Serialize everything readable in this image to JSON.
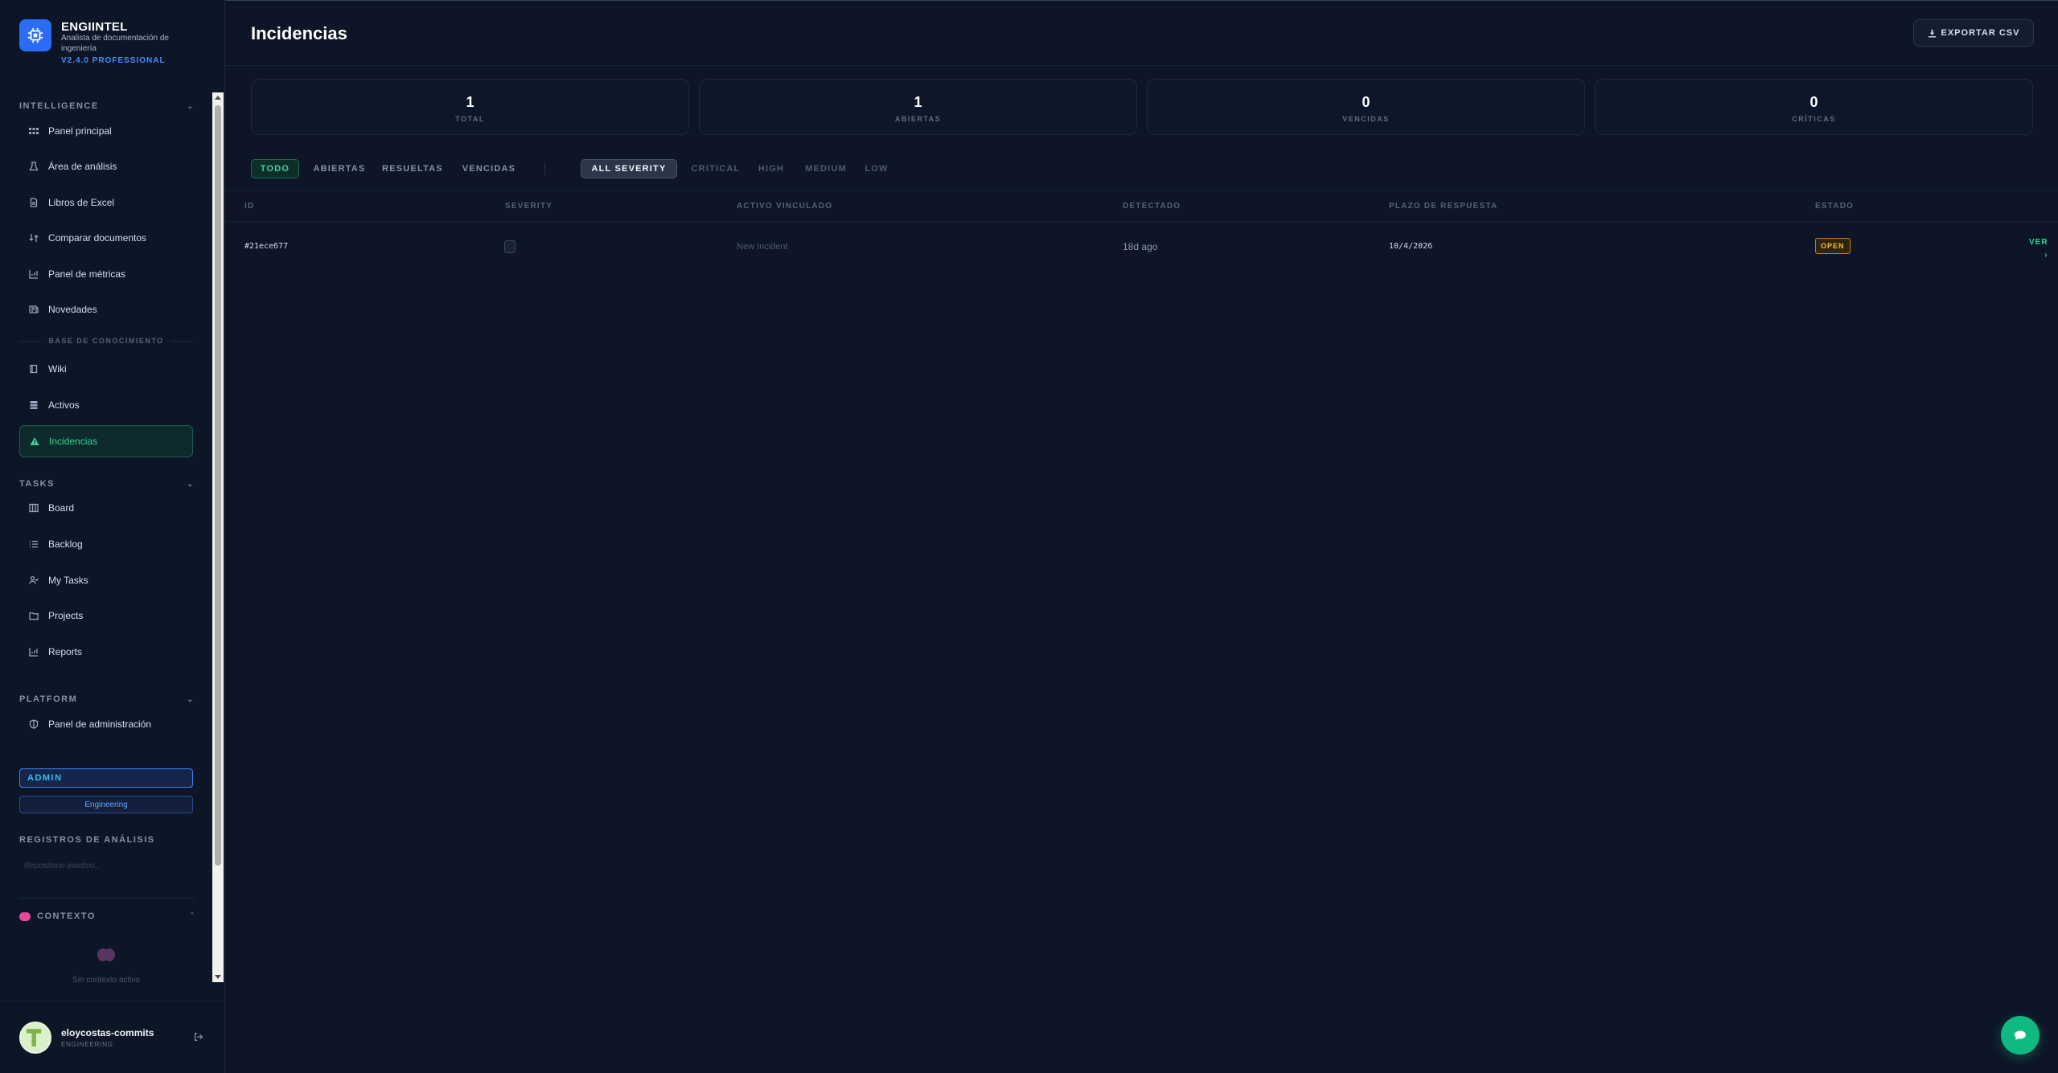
{
  "brand": {
    "name": "ENGIINTEL",
    "subtitle": "Analista de documentación de ingeniería",
    "version": "V2.4.0 PROFESSIONAL"
  },
  "sidebar": {
    "intelligence": {
      "title": "INTELLIGENCE",
      "items": [
        {
          "label": "Panel principal",
          "icon": "grid-icon"
        },
        {
          "label": "Área de análisis",
          "icon": "flask-icon"
        },
        {
          "label": "Libros de Excel",
          "icon": "file-icon"
        },
        {
          "label": "Comparar documentos",
          "icon": "compare-icon"
        },
        {
          "label": "Panel de métricas",
          "icon": "chart-icon"
        },
        {
          "label": "Novedades",
          "icon": "news-icon"
        }
      ]
    },
    "knowledge": {
      "title": "BASE DE CONOCIMIENTO",
      "items": [
        {
          "label": "Wiki",
          "icon": "book-icon"
        },
        {
          "label": "Activos",
          "icon": "database-icon"
        },
        {
          "label": "Incidencias",
          "icon": "warning-icon",
          "active": true
        }
      ]
    },
    "tasks": {
      "title": "TASKS",
      "items": [
        {
          "label": "Board",
          "icon": "board-icon"
        },
        {
          "label": "Backlog",
          "icon": "list-icon"
        },
        {
          "label": "My Tasks",
          "icon": "user-check-icon"
        },
        {
          "label": "Projects",
          "icon": "folder-icon"
        },
        {
          "label": "Reports",
          "icon": "chart-icon"
        }
      ]
    },
    "platform": {
      "title": "PLATFORM",
      "items": [
        {
          "label": "Panel de administración",
          "icon": "shield-icon"
        }
      ]
    },
    "role_badge": "ADMIN",
    "department_badge": "Engineering",
    "logs": {
      "title": "REGISTROS DE ANÁLISIS",
      "empty": "Repositorio inactivo..."
    },
    "context": {
      "title": "CONTEXTO",
      "empty": "Sin contexto activo"
    }
  },
  "user": {
    "name": "eloycostas-commits",
    "role": "ENGINEERING"
  },
  "page": {
    "title": "Incidencias",
    "export_label": "EXPORTAR CSV"
  },
  "stats": [
    {
      "value": "1",
      "label": "TOTAL"
    },
    {
      "value": "1",
      "label": "ABIERTAS"
    },
    {
      "value": "0",
      "label": "VENCIDAS"
    },
    {
      "value": "0",
      "label": "CRÍTICAS"
    }
  ],
  "filters": {
    "status": [
      "TODO",
      "ABIERTAS",
      "RESUELTAS",
      "VENCIDAS"
    ],
    "severity": [
      "ALL SEVERITY",
      "CRITICAL",
      "HIGH",
      "MEDIUM",
      "LOW"
    ]
  },
  "table": {
    "columns": [
      "ID",
      "SEVERITY",
      "ACTIVO VINCULADO",
      "DETECTADO",
      "PLAZO DE RESPUESTA",
      "ESTADO"
    ],
    "rows": [
      {
        "id": "#21ece677",
        "asset": "New Incident",
        "detected": "18d ago",
        "deadline": "10/4/2026",
        "status": "OPEN",
        "action": "VER",
        "action_arrow": "›"
      }
    ]
  },
  "colors": {
    "accent_green": "#34d399",
    "brand_blue": "#2a6df4",
    "status_open": "#fbbf24",
    "background": "#0d1526"
  }
}
